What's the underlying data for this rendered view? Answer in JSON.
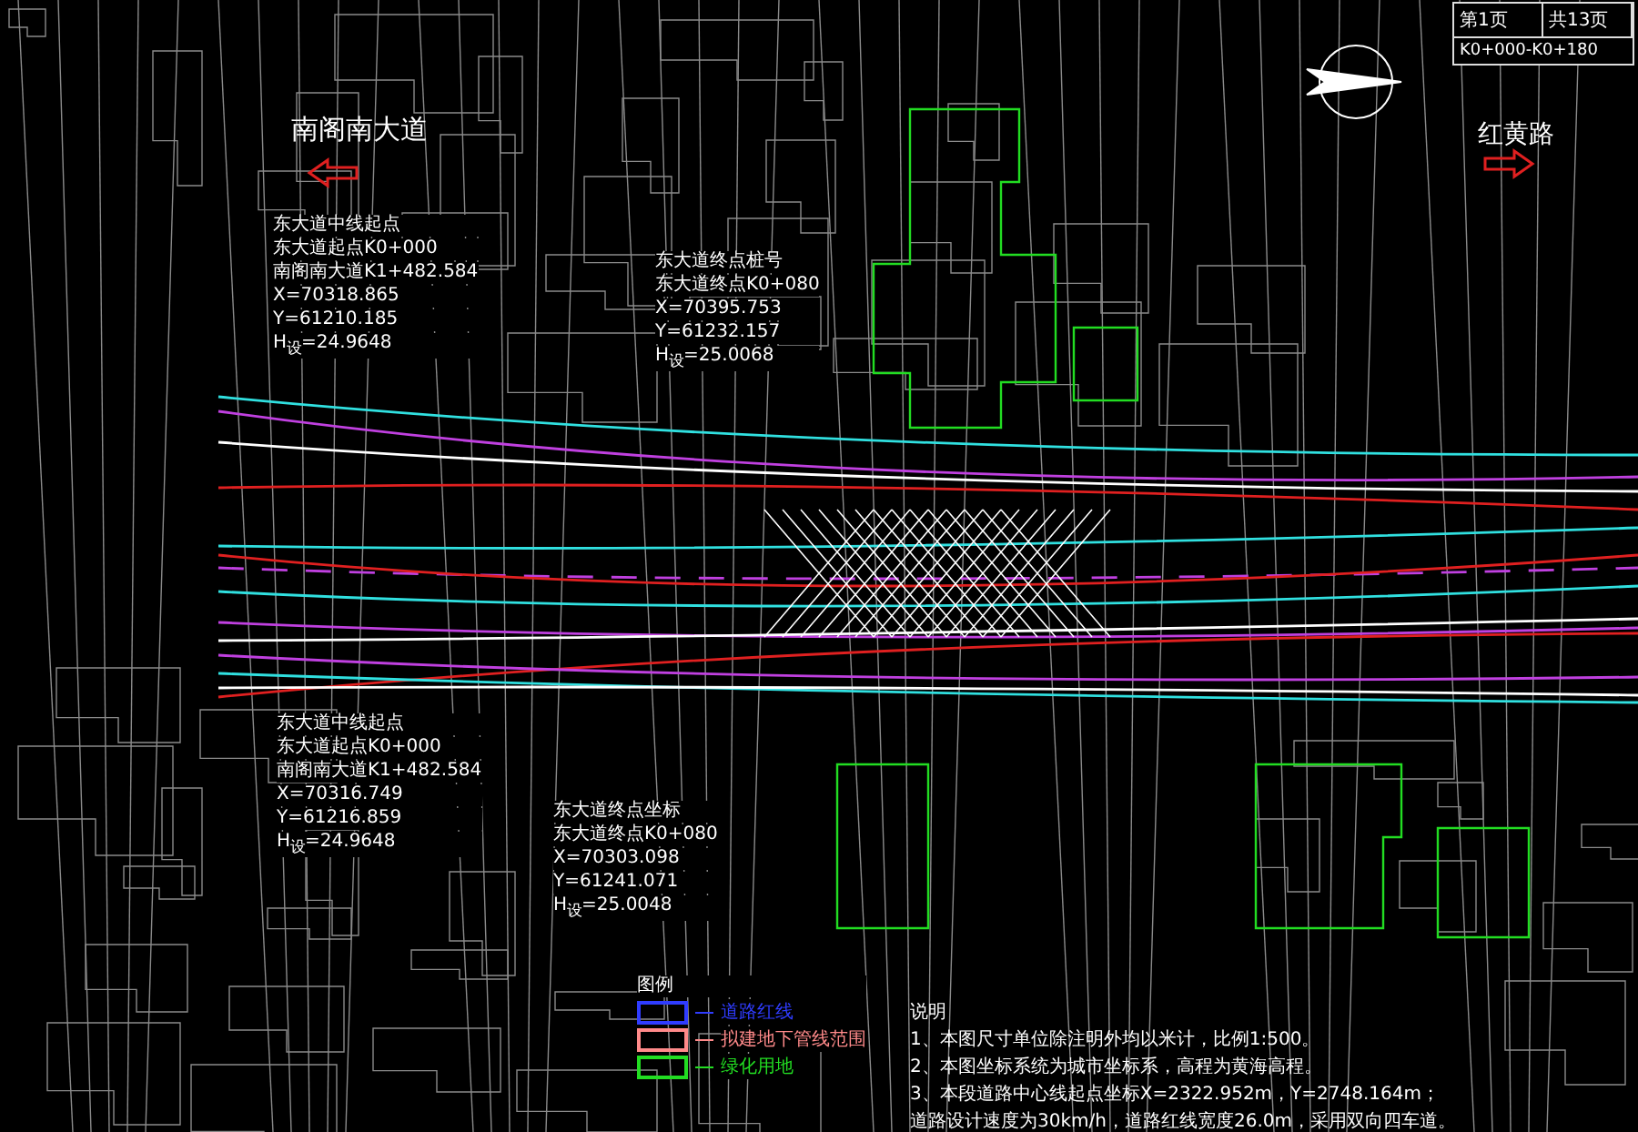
{
  "title_block": {
    "page": "第1页",
    "total": "共13页",
    "range": "K0+000-K0+180"
  },
  "road_labels": [
    "南阁南大道",
    "红黄路"
  ],
  "annotations": [
    {
      "lines": [
        "东大道中线起点",
        "东大道起点K0+000",
        "南阁南大道K1+482.584",
        "X=70318.865",
        "Y=61210.185",
        "H$_{设}$=24.9648"
      ]
    },
    {
      "lines": [
        "东大道终点桩号",
        "东大道终点K0+080",
        "X=70395.753",
        "Y=61232.157",
        "H$_{设}$=25.0068"
      ]
    },
    {
      "lines": [
        "东大道中线起点",
        "东大道起点K0+000",
        "南阁南大道K1+482.584",
        "X=70316.749",
        "Y=61216.859",
        "H$_{设}$=24.9648"
      ]
    },
    {
      "lines": [
        "东大道终点坐标",
        "东大道终点K0+080",
        "X=70303.098",
        "Y=61241.071",
        "H$_{设}$=25.0048"
      ]
    }
  ],
  "legend": {
    "title": "图例",
    "items": [
      {
        "label": "道路红线",
        "color": "#2f3cff"
      },
      {
        "label": "拟建地下管线范围",
        "color": "#ff8a8a"
      },
      {
        "label": "绿化用地",
        "color": "#22dd22"
      }
    ]
  },
  "notes": {
    "title": "说明",
    "items": [
      "1、本图尺寸单位除注明外均以米计，比例1:500。",
      "2、本图坐标系统为城市坐标系，高程为黄海高程。",
      "3、本段道路中心线起点坐标X=2322.952m，Y=2748.164m；",
      "道路设计速度为30km/h，道路红线宽度26.0m，采用双向四车道。"
    ]
  }
}
